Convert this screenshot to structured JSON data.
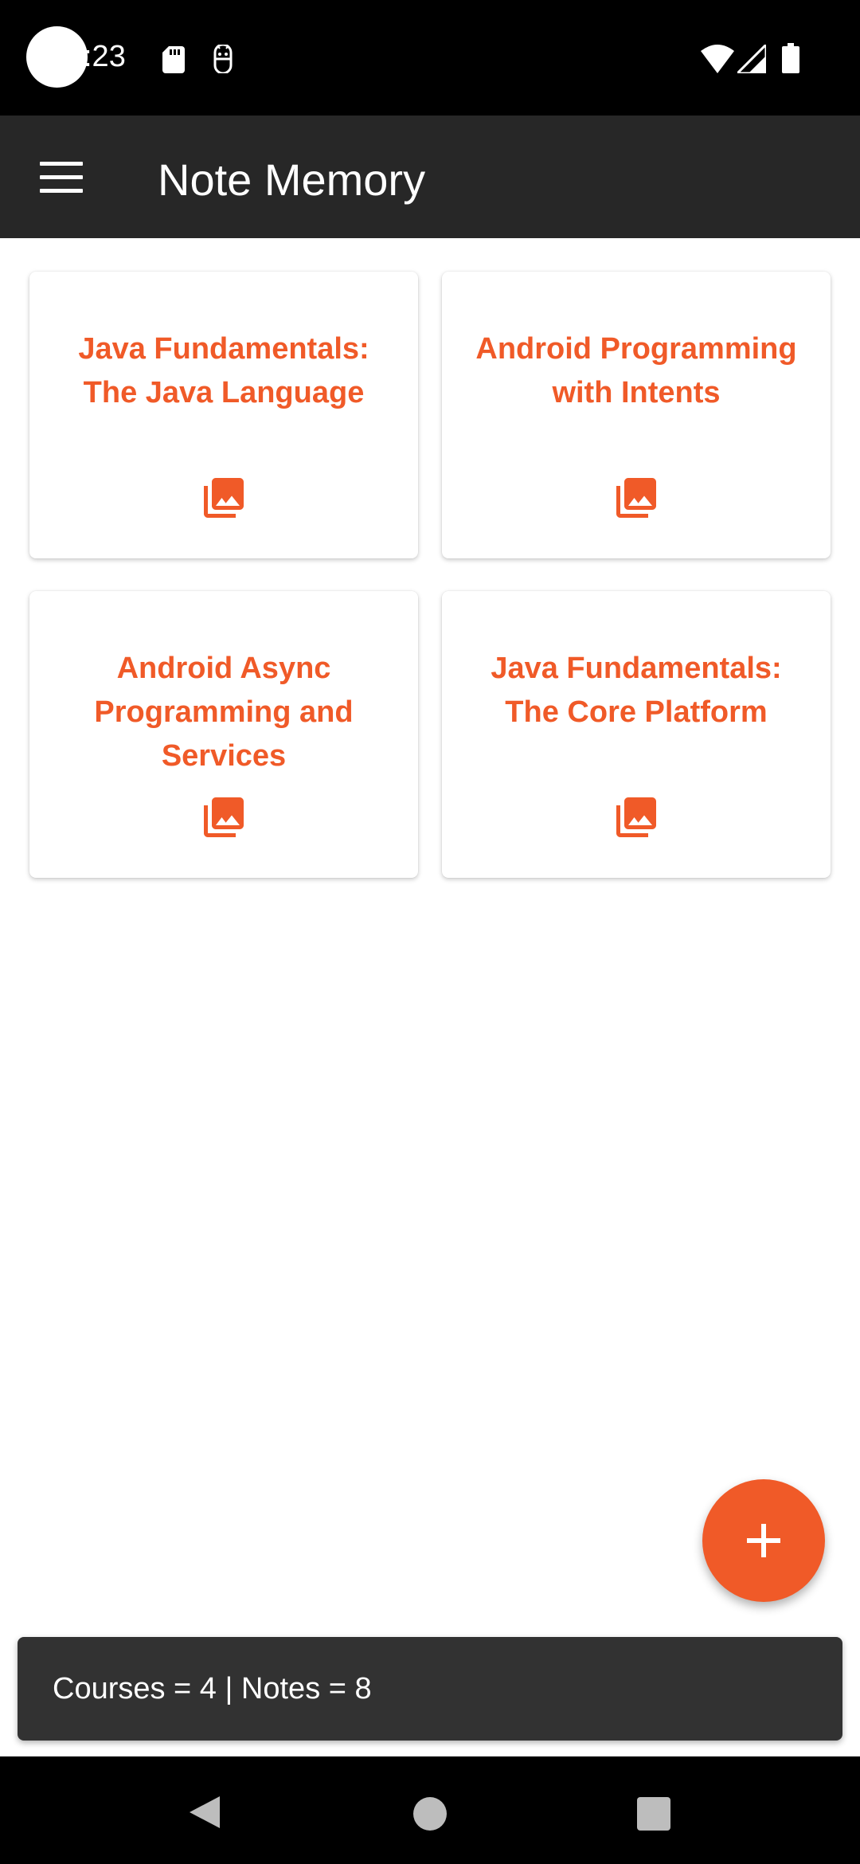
{
  "status_bar": {
    "time": ":23",
    "icons": [
      "sd-card-icon",
      "android-debug-icon",
      "wifi-icon",
      "signal-icon",
      "battery-icon"
    ]
  },
  "app_bar": {
    "title": "Note Memory",
    "menu_icon": "menu-icon"
  },
  "courses": [
    {
      "title": "Java Fundamentals: The Java Language",
      "icon": "photo-library-icon"
    },
    {
      "title": "Android Programming with Intents",
      "icon": "photo-library-icon"
    },
    {
      "title": "Android Async Programming and Services",
      "icon": "photo-library-icon"
    },
    {
      "title": "Java Fundamentals: The Core Platform",
      "icon": "photo-library-icon"
    }
  ],
  "fab": {
    "icon": "add-icon"
  },
  "snackbar": {
    "message": "Courses = 4 | Notes = 8"
  },
  "nav_bar": {
    "icons": [
      "back-icon",
      "home-icon",
      "recents-icon"
    ]
  },
  "colors": {
    "accent": "#F05A28",
    "app_bar": "#272727",
    "snackbar": "#323232"
  }
}
